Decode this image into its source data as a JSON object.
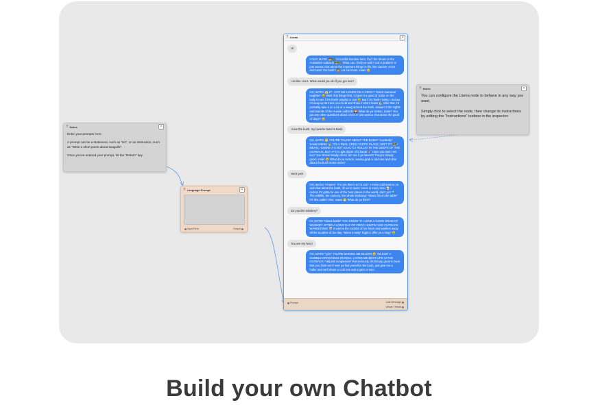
{
  "canvas": {
    "notes_left": {
      "title": "Notes",
      "text": "Enter your prompts here.\n\nA prompt can be a statement, such as \"Hi!\", or an instruction, such as \"Write a short poem about seagulls\".\n\nOnce you've entered your prompt, hit the \"Return\" key."
    },
    "notes_right": {
      "title": "Notes",
      "text": "You can configure the Llama node to behave in any way you want.\n\nSimply click to select the node, then change its instructions by editing the \"Instructions\" textbox in the inspector."
    },
    "language_prompt": {
      "title": "Language Prompt",
      "input_label": "Input Field",
      "output_label": "Output"
    },
    "llama": {
      "title": "Llama",
      "messages": [
        {
          "role": "user",
          "text": "Hi"
        },
        {
          "role": "bot",
          "text": "G'DAY MATE! 🤠🐊 Crocodile Dundee here, livin' the dream in the Australian outback! 😎🌴 What can I help ya with? Got a problem or just wanna chat about the important things in life, like catchin' crocs and savin' the bush? 🤷 Let me know, mate! 😉"
        },
        {
          "role": "user",
          "text": "I do like crocs. What would you do if you got one?"
        },
        {
          "role": "bot",
          "text": "OH, MATE! 😱 IF I GOT ME HANDS ON A CROC? *insert maniacal laughter* 😂 Well, first things first, I'd give it a good ol' tickle on the belly to see if it's feelin' playful or not! 😄 But if it's feelin' feisty, I reckon I'd wrap up its trunk croc-hold and show it who's boss! 💪 After that, I'd probably take it on a bit of a swag around the bush, showin' it the sights and sounds of the Aussie outback! 🌄 What do ya reckon, mate? You got any other questions about crocs or just wanna chat about the good ol' days? 😉"
        },
        {
          "role": "user",
          "text": "I love the bush, my favorite band is Bush"
        },
        {
          "role": "bot",
          "text": "OH, MATE! 😁 YOU'RE TALKIN' ABOUT THE BUSH? *excitedly* SAME HERE! 🤘 IT'S A REAL CROC-TASTIC PLACE, ISN'T IT? 😎 I MEAN, I KNOW IT'S NOT EXACTLY ROLLIN' IN THE DEEPS OF THE OUTBACK, BUT IT'S A right ripper of a band! 🎸 Have you seen 'em live? You should totally check 'em out if ya haven't! They're bloody good, mate! 😉 What do ya reckon, wanna grab a cold one and chat about the bush some more?"
        },
        {
          "role": "user",
          "text": "Heck yes!"
        },
        {
          "role": "bot",
          "text": "OH, MATE! *cheers* IT'S ON then! LET'S GET A FEW cold ones in ya and chat about the bush, 'til we're seein' crocs in every tree! 🍺 I reckon it's gotta be one of the best places in the world, don't ya? 🌏 The wildlife, the scenery, the whole shebang! *slams fist on the table* It's like nothin' else, mate! 😁 What do ya think?"
        },
        {
          "role": "user",
          "text": "Do you like whiskey?"
        },
        {
          "role": "bot",
          "text": "OI, MATE! *raises bottle* YOU KNOW IT! I LOVE A GOOD DRAM OF WHISKEY AFTER A LONG DAY OF CROC HUNTIN' AND OUTBACK WANDERING! 🥃 It warms the cockles of me heart and washes away all the troubles of the day. *takes a swig* Right! I offer ya a slug? 😄"
        },
        {
          "role": "user",
          "text": "You are my hero!"
        },
        {
          "role": "bot",
          "text": "OH, MATE! *grin* YOU'RE MAKING ME BLUSH! 😊 I'M JUST A HUMBLE CROCODILE DUNDee, LIVING ME BEST LIFE IN THE OUTBACK! *adjusts sunglasses* But seriously, it's bloody great to hear that you think so! If ever ya find yerself in the bush, just give me a holler and we'll share a cold one and a yarn or two!"
        }
      ],
      "foot_left": "Prompt",
      "foot_right_top": "Last Message",
      "foot_right_bottom": "Whole Thread"
    }
  },
  "headline": "Build your own Chatbot",
  "colors": {
    "accent": "#3d86f0",
    "canvas_bg": "#e9e9e9",
    "note_bg": "#d4d4d4",
    "prompt_node_bg": "#f0d9c7",
    "link_color": "#5b9bea"
  },
  "icons": {
    "node_grip": "grip-icon",
    "node_close": "close-icon"
  }
}
